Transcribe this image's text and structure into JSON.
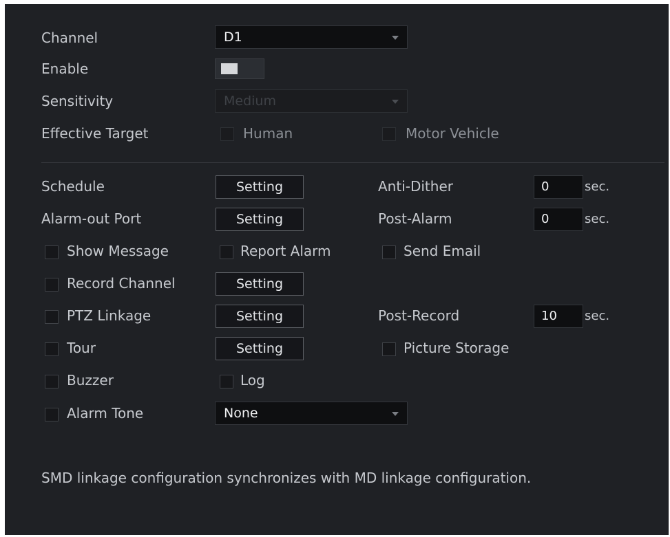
{
  "channel": {
    "label": "Channel",
    "value": "D1"
  },
  "enable": {
    "label": "Enable",
    "on": true
  },
  "sensitivity": {
    "label": "Sensitivity",
    "value": "Medium"
  },
  "effective_target": {
    "label": "Effective Target",
    "human": "Human",
    "motor_vehicle": "Motor Vehicle"
  },
  "schedule": {
    "label": "Schedule",
    "button": "Setting"
  },
  "anti_dither": {
    "label": "Anti-Dither",
    "value": "0",
    "unit": "sec."
  },
  "alarm_out_port": {
    "label": "Alarm-out Port",
    "button": "Setting"
  },
  "post_alarm": {
    "label": "Post-Alarm",
    "value": "0",
    "unit": "sec."
  },
  "show_message": {
    "label": "Show Message"
  },
  "report_alarm": {
    "label": "Report Alarm"
  },
  "send_email": {
    "label": "Send Email"
  },
  "record_channel": {
    "label": "Record Channel",
    "button": "Setting"
  },
  "ptz_linkage": {
    "label": "PTZ Linkage",
    "button": "Setting"
  },
  "post_record": {
    "label": "Post-Record",
    "value": "10",
    "unit": "sec."
  },
  "tour": {
    "label": "Tour",
    "button": "Setting"
  },
  "picture_storage": {
    "label": "Picture Storage"
  },
  "buzzer": {
    "label": "Buzzer"
  },
  "log": {
    "label": "Log"
  },
  "alarm_tone": {
    "label": "Alarm Tone",
    "value": "None"
  },
  "note": "SMD linkage configuration synchronizes with MD linkage configuration.",
  "colors": {
    "panel_bg": "#1f2125",
    "field_bg": "#0e0f11",
    "button_border": "#5c5f64",
    "text": "#c6c9ce"
  }
}
